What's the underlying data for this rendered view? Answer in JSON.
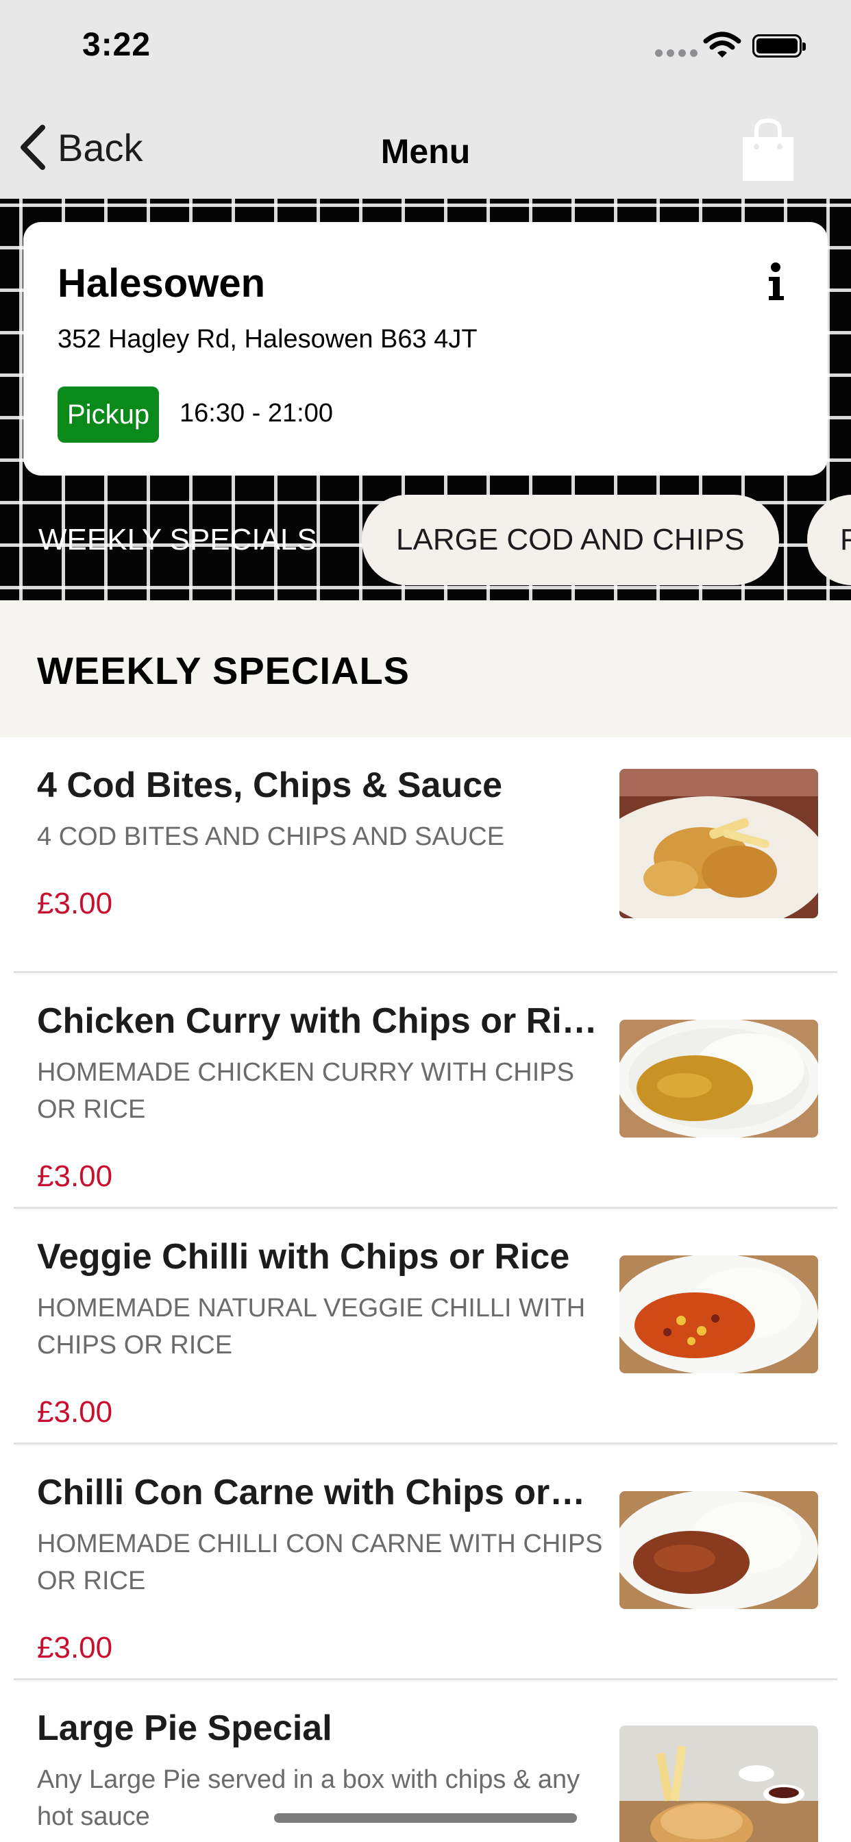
{
  "status_bar": {
    "time": "3:22"
  },
  "nav": {
    "back_label": "Back",
    "title": "Menu"
  },
  "store": {
    "name": "Halesowen",
    "address": "352 Hagley Rd, Halesowen B63 4JT",
    "mode": "Pickup",
    "hours": "16:30 - 21:00"
  },
  "tabs": [
    {
      "label": "WEEKLY SPECIALS"
    },
    {
      "label": "LARGE COD AND CHIPS"
    },
    {
      "label": "F"
    }
  ],
  "section": {
    "title": "WEEKLY SPECIALS"
  },
  "items": [
    {
      "name": "4 Cod Bites, Chips & Sauce",
      "description": "4 COD BITES AND CHIPS AND SAUCE",
      "price": "£3.00",
      "image": "cod-bites-plate"
    },
    {
      "name": "Chicken Curry with Chips or Rice",
      "description": "HOMEMADE CHICKEN CURRY WITH CHIPS OR RICE",
      "price": "£3.00",
      "image": "chicken-curry-bowl"
    },
    {
      "name": "Veggie Chilli with Chips or Rice",
      "description": "HOMEMADE NATURAL  VEGGIE CHILLI WITH CHIPS OR RICE",
      "price": "£3.00",
      "image": "veggie-chilli-bowl"
    },
    {
      "name": "Chilli Con Carne with Chips or…",
      "description": "HOMEMADE CHILLI CON CARNE WITH CHIPS OR RICE",
      "price": "£3.00",
      "image": "chilli-con-carne-bowl"
    },
    {
      "name": "Large Pie Special",
      "description": "Any Large Pie served in a box with chips & any hot sauce",
      "price": "",
      "image": "pie-with-chips"
    }
  ],
  "colors": {
    "price": "#c8102e",
    "pickup": "#0a8a1a",
    "header_bg": "#e8e8e8",
    "section_bg": "#f6f4f1"
  },
  "icons": [
    "chevron-left-icon",
    "shopping-bag-icon",
    "info-icon",
    "wifi-icon",
    "battery-icon"
  ]
}
